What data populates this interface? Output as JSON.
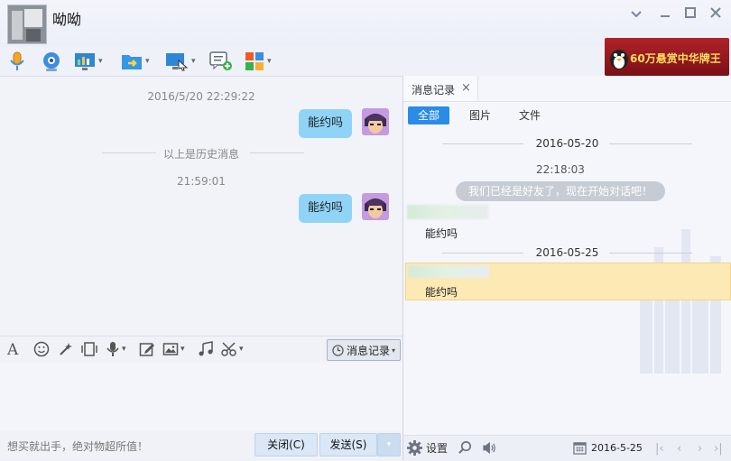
{
  "window": {
    "contact_name": "呦呦",
    "controls": [
      "chevron-down-icon",
      "minimize-icon",
      "maximize-icon",
      "close-icon"
    ]
  },
  "ad_banner": {
    "text": "60万悬赏中华牌王"
  },
  "toolbar": {
    "icons": [
      "microphone-icon",
      "webcam-icon",
      "app-share-icon",
      "file-transfer-icon",
      "remote-desktop-icon",
      "new-chat-icon",
      "apps-grid-icon"
    ]
  },
  "chat": {
    "messages": [
      {
        "type": "timestamp",
        "text": "2016/5/20 22:29:22"
      },
      {
        "type": "outgoing",
        "text": "能约吗"
      },
      {
        "type": "separator",
        "text": "以上是历史消息"
      },
      {
        "type": "timestamp",
        "text": "21:59:01"
      },
      {
        "type": "outgoing",
        "text": "能约吗"
      }
    ]
  },
  "input_toolbar": {
    "icons": [
      "font-icon",
      "emoji-icon",
      "magic-wand-icon",
      "shake-window-icon",
      "voice-message-icon",
      "edit-image-icon",
      "image-icon",
      "music-icon",
      "screenshot-scissors-icon"
    ],
    "history_button": "消息记录"
  },
  "input": {
    "ad_text": "想买就出手，绝对物超所值！"
  },
  "buttons": {
    "close": "关闭(C)",
    "send": "发送(S)"
  },
  "history": {
    "tab_label": "消息记录",
    "filters": [
      "全部",
      "图片",
      "文件"
    ],
    "active_filter": "全部",
    "entries": [
      {
        "type": "date",
        "text": "2016-05-20"
      },
      {
        "type": "time",
        "text": "22:18:03"
      },
      {
        "type": "system",
        "text": "我们已经是好友了，现在开始对话吧！"
      },
      {
        "type": "message",
        "text": "能约吗"
      },
      {
        "type": "date",
        "text": "2016-05-25"
      },
      {
        "type": "message",
        "text": "能约吗",
        "highlighted": true
      }
    ],
    "bottom": {
      "settings_label": "设置",
      "date": "2016-5-25"
    }
  },
  "colors": {
    "bubble": "#8fd3f7",
    "active_filter": "#2b8ce6",
    "highlight_row": "#fde9b4",
    "ad_banner": "#b1222a"
  }
}
